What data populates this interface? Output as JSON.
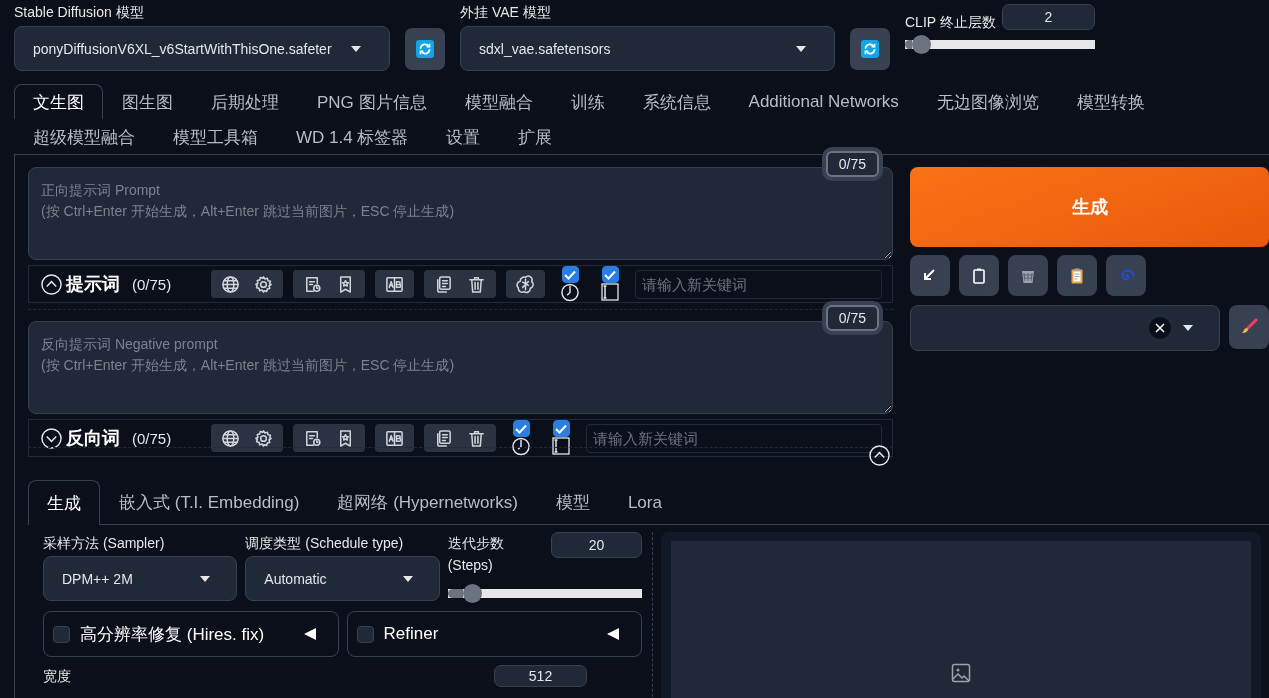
{
  "model_selectors": [
    {
      "label": "Stable Diffusion 模型",
      "value": "ponyDiffusionV6XL_v6StartWithThisOne.safeter"
    },
    {
      "label": "外挂 VAE 模型",
      "value": "sdxl_vae.safetensors"
    }
  ],
  "clip_skip": {
    "label": "CLIP 终止层数",
    "value": "2",
    "level": 0.09
  },
  "tabs": [
    {
      "label": "文生图",
      "selected": true
    },
    {
      "label": "图生图",
      "selected": false
    },
    {
      "label": "后期处理",
      "selected": false
    },
    {
      "label": "PNG 图片信息",
      "selected": false
    },
    {
      "label": "模型融合",
      "selected": false
    },
    {
      "label": "训练",
      "selected": false
    },
    {
      "label": "系统信息",
      "selected": false
    },
    {
      "label": "Additional Networks",
      "selected": false
    },
    {
      "label": "无边图像浏览",
      "selected": false
    },
    {
      "label": "模型转换",
      "selected": false
    },
    {
      "label": "超级模型融合",
      "selected": false
    },
    {
      "label": "模型工具箱",
      "selected": false
    },
    {
      "label": "WD 1.4 标签器",
      "selected": false
    },
    {
      "label": "设置",
      "selected": false
    },
    {
      "label": "扩展",
      "selected": false
    }
  ],
  "prompts": [
    {
      "placeholder": "正向提示词 Prompt\n(按 Ctrl+Enter 开始生成，Alt+Enter 跳过当前图片，ESC 停止生成)",
      "token_count": "0/75",
      "title": "提示词",
      "count": "(0/75)",
      "expanded": true,
      "ai_button": true,
      "checkboxes": [
        {
          "checked": true
        },
        {
          "checked": true
        }
      ],
      "keyword_placeholder": "请输入新关键词"
    },
    {
      "placeholder": "反向提示词 Negative prompt\n(按 Ctrl+Enter 开始生成，Alt+Enter 跳过当前图片，ESC 停止生成)",
      "token_count": "0/75",
      "title": "反向词",
      "count": "(0/75)",
      "expanded": false,
      "ai_button": false,
      "checkboxes": [
        {
          "checked": true
        },
        {
          "checked": true
        }
      ],
      "keyword_placeholder": "请输入新关键词"
    }
  ],
  "generate_button": {
    "label": "生成"
  },
  "settings_tabs": [
    {
      "label": "生成",
      "selected": true
    },
    {
      "label": "嵌入式 (T.I. Embedding)",
      "selected": false
    },
    {
      "label": "超网络 (Hypernetworks)",
      "selected": false
    },
    {
      "label": "模型",
      "selected": false
    },
    {
      "label": "Lora",
      "selected": false
    }
  ],
  "sampler": {
    "label": "采样方法 (Sampler)",
    "value": "DPM++ 2M"
  },
  "schedule": {
    "label": "调度类型 (Schedule type)",
    "value": "Automatic"
  },
  "steps": {
    "label": "迭代步数 (Steps)",
    "value": "20",
    "level": 0.13
  },
  "accordions": [
    {
      "label": "高分辨率修复 (Hires. fix)",
      "checked": false
    },
    {
      "label": "Refiner",
      "checked": false
    }
  ],
  "width": {
    "label": "宽度",
    "value": "512"
  }
}
